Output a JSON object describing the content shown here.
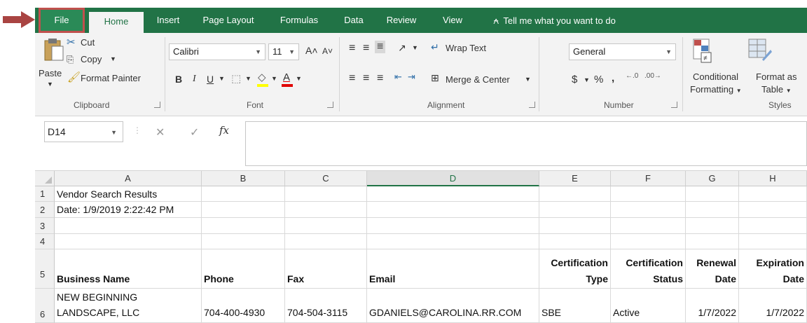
{
  "ribbon_tabs": {
    "file": "File",
    "home": "Home",
    "insert": "Insert",
    "page_layout": "Page Layout",
    "formulas": "Formulas",
    "data": "Data",
    "review": "Review",
    "view": "View",
    "tell_me": "Tell me what you want to do"
  },
  "clipboard": {
    "paste": "Paste",
    "cut": "Cut",
    "copy": "Copy",
    "format_painter": "Format Painter",
    "label": "Clipboard"
  },
  "font": {
    "name": "Calibri",
    "size": "11",
    "label": "Font"
  },
  "alignment": {
    "wrap_text": "Wrap Text",
    "merge_center": "Merge & Center",
    "label": "Alignment"
  },
  "number": {
    "format": "General",
    "label": "Number"
  },
  "styles": {
    "conditional_1": "Conditional",
    "conditional_2": "Formatting",
    "format_as_1": "Format as",
    "format_as_2": "Table",
    "label": "Styles"
  },
  "formula_bar": {
    "name_box": "D14",
    "fx": "fx"
  },
  "columns": [
    "A",
    "B",
    "C",
    "D",
    "E",
    "F",
    "G",
    "H"
  ],
  "rows": [
    "1",
    "2",
    "3",
    "4",
    "5",
    "6"
  ],
  "sheet": {
    "a1": "Vendor Search Results",
    "a2": "Date: 1/9/2019 2:22:42 PM",
    "headers": {
      "business_name": "Business Name",
      "phone": "Phone",
      "fax": "Fax",
      "email": "Email",
      "cert_type_1": "Certification",
      "cert_type_2": "Type",
      "cert_status_1": "Certification",
      "cert_status_2": "Status",
      "renewal_1": "Renewal",
      "renewal_2": "Date",
      "expiration_1": "Expiration",
      "expiration_2": "Date"
    },
    "row6": {
      "business_1": "NEW BEGINNING",
      "business_2": "LANDSCAPE, LLC",
      "phone": "704-400-4930",
      "fax": "704-504-3115",
      "email": "GDANIELS@CAROLINA.RR.COM",
      "cert_type": "SBE",
      "cert_status": "Active",
      "renewal": "1/7/2022",
      "expiration": "1/7/2022"
    }
  },
  "colors": {
    "excel_green": "#217346",
    "highlight_red": "#c0504d",
    "arrow": "#a94442"
  }
}
